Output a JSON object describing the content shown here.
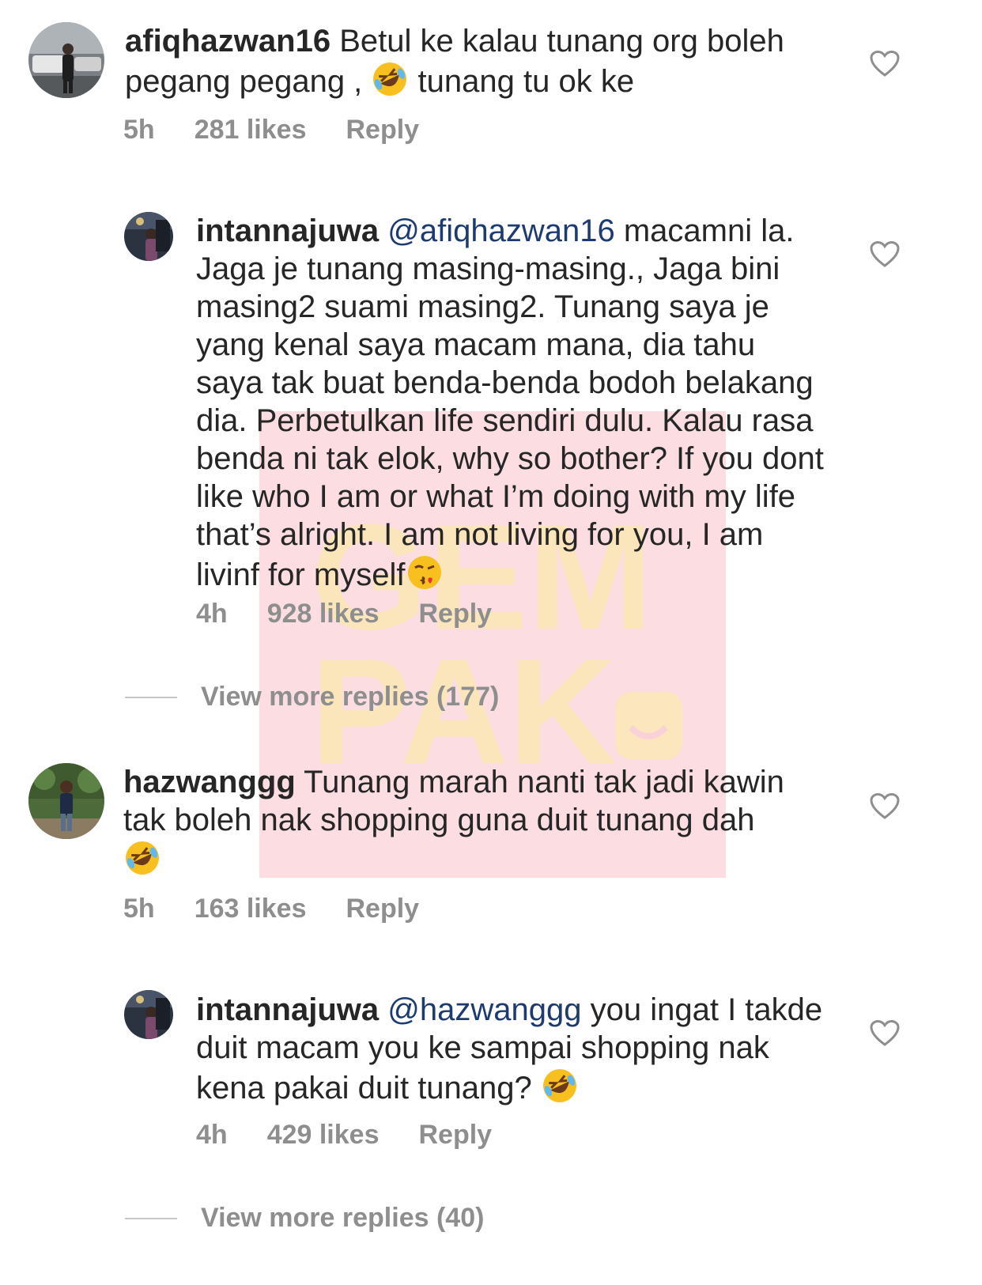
{
  "comments": [
    {
      "username": "afiqhazwan16",
      "text_before_emoji": "Betul ke kalau tunang org boleh pegang pegang ,",
      "text_after_emoji": "tunang tu ok ke",
      "time": "5h",
      "likes": "281 likes",
      "reply": "Reply"
    },
    {
      "username": "intannajuwa",
      "mention": "@afiqhazwan16",
      "text": "macamni la. Jaga je tunang masing-masing., Jaga bini masing2 suami masing2. Tunang saya je yang kenal saya macam mana, dia tahu saya tak buat benda-benda bodoh belakang dia. Perbetulkan life sendiri dulu. Kalau rasa benda ni tak elok, why so bother? If you dont like who I am or what I’m doing with my life that’s alright. I am not living for you, I am livinf for myself",
      "time": "4h",
      "likes": "928 likes",
      "reply": "Reply"
    },
    {
      "username": "hazwanggg",
      "text": "Tunang marah nanti tak jadi kawin tak boleh nak shopping guna duit tunang dah",
      "time": "5h",
      "likes": "163 likes",
      "reply": "Reply"
    },
    {
      "username": "intannajuwa",
      "mention": "@hazwanggg",
      "text": "you ingat I takde duit macam you ke sampai shopping nak kena pakai duit tunang?",
      "time": "4h",
      "likes": "429 likes",
      "reply": "Reply"
    }
  ],
  "view_more": [
    "View more replies (177)",
    "View more replies (40)"
  ],
  "watermark": {
    "line1": "GEM",
    "line2": "PAK"
  },
  "icons": {
    "like": "heart-outline-icon",
    "laughing": "rolling-laughing-emoji",
    "kiss": "face-blowing-kiss-emoji"
  },
  "colors": {
    "text": "#262626",
    "meta": "#8e8e8e",
    "mention": "#1d3b70",
    "watermark_bg": "#f9d2d8",
    "watermark_letters": "#fbe8b6"
  }
}
